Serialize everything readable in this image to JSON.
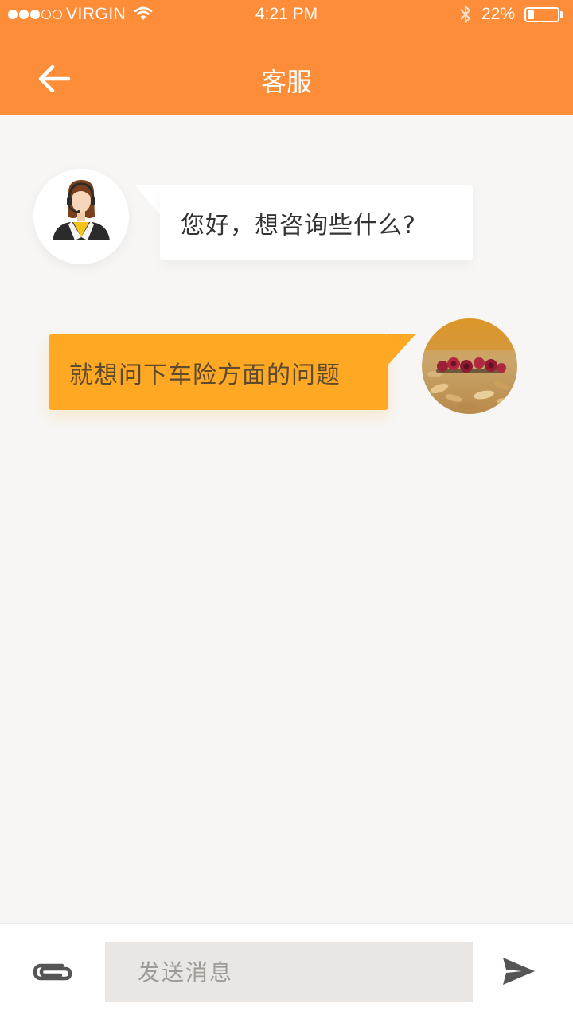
{
  "status_bar": {
    "carrier": "VIRGIN",
    "time": "4:21 PM",
    "battery_percent": "22%",
    "battery_level": 0.22,
    "signal_filled": 3,
    "signal_total": 5
  },
  "header": {
    "title": "客服",
    "back_icon": "arrow-left-icon"
  },
  "messages": [
    {
      "sender": "agent",
      "text": "您好，想咨询些什么?",
      "avatar_icon": "support-agent-icon"
    },
    {
      "sender": "user",
      "text": "就想问下车险方面的问题",
      "avatar_icon": "user-photo-roses"
    }
  ],
  "input_bar": {
    "placeholder": "发送消息",
    "value": "",
    "attach_icon": "paperclip-icon",
    "send_icon": "send-icon"
  },
  "colors": {
    "header_bg": "#fd8d39",
    "user_bubble": "#fea824",
    "agent_bubble": "#ffffff",
    "page_bg": "#f7f6f4",
    "input_bg": "#e9e6e3"
  }
}
